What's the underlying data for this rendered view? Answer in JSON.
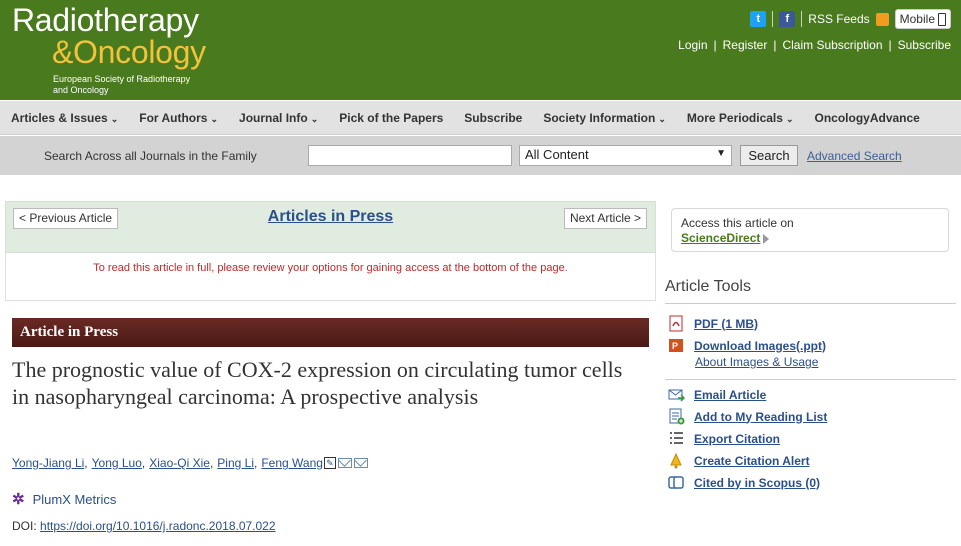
{
  "header": {
    "logo_line1": "Radiotherapy",
    "logo_line2": "&Oncology",
    "logo_sub": "European Society of Radiotherapy and Oncology",
    "rss_label": "RSS Feeds",
    "mobile_label": "Mobile",
    "user_links": [
      "Login",
      "Register",
      "Claim Subscription",
      "Subscribe"
    ]
  },
  "nav": {
    "items": [
      {
        "label": "Articles & Issues",
        "has_menu": true
      },
      {
        "label": "For Authors",
        "has_menu": true
      },
      {
        "label": "Journal Info",
        "has_menu": true
      },
      {
        "label": "Pick of the Papers",
        "has_menu": false
      },
      {
        "label": "Subscribe",
        "has_menu": false
      },
      {
        "label": "Society Information",
        "has_menu": true
      },
      {
        "label": "More Periodicals",
        "has_menu": true
      },
      {
        "label": "OncologyAdvance",
        "has_menu": false
      }
    ]
  },
  "search": {
    "label": "Search Across all Journals in the Family",
    "input_value": "",
    "scope_selected": "All Content",
    "button_label": "Search",
    "advanced_label": "Advanced Search"
  },
  "article_nav": {
    "prev_label": "< Previous Article",
    "center_label": "Articles in Press",
    "next_label": "Next Article >",
    "notice": "To read this article in full, please review your options for gaining access at the bottom of the page."
  },
  "article": {
    "banner": "Article in Press",
    "title": "The prognostic value of COX-2 expression on circulating tumor cells in nasopharyngeal carcinoma: A prospective analysis",
    "authors": [
      "Yong-Jiang Li",
      "Yong Luo",
      "Xiao-Qi Xie",
      "Ping Li",
      "Feng Wang"
    ],
    "plumx_label": "PlumX Metrics",
    "doi_prefix": "DOI: ",
    "doi_link": "https://doi.org/10.1016/j.radonc.2018.07.022"
  },
  "sidebar": {
    "access_text": "Access this article on",
    "access_link": "ScienceDirect",
    "tools_heading": "Article Tools",
    "tools": [
      {
        "label": "PDF (1 MB)",
        "icon": "pdf-icon"
      },
      {
        "label": "Download Images(.ppt)",
        "icon": "ppt-icon"
      },
      {
        "label": "Email Article",
        "icon": "email-article-icon"
      },
      {
        "label": "Add to My Reading List",
        "icon": "reading-list-icon"
      },
      {
        "label": "Export Citation",
        "icon": "export-citation-icon"
      },
      {
        "label": "Create Citation Alert",
        "icon": "citation-alert-icon"
      },
      {
        "label": "Cited by in Scopus (0)",
        "icon": "scopus-icon"
      }
    ],
    "about_images": "About Images & Usage"
  },
  "colors": {
    "header_green": "#4a7a1e",
    "logo_gold": "#f3c23b",
    "link_blue": "#2b4f8a",
    "banner_brown": "#5a221d",
    "notice_red": "#c0292b"
  }
}
